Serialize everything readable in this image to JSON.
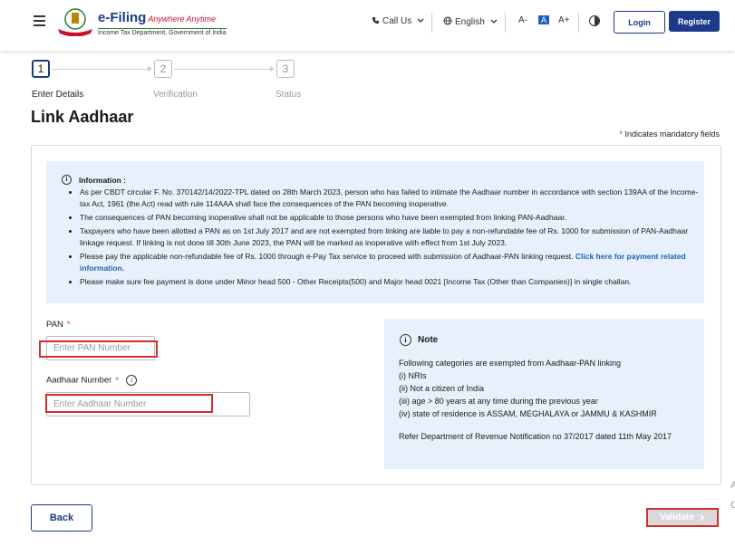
{
  "header": {
    "brand_name": "e-Filing",
    "brand_tagline": "Anywhere Anytime",
    "brand_dept": "Income Tax Department, Government of India",
    "call_us": "Call Us",
    "language": "English",
    "font_smaller": "A-",
    "font_default": "A",
    "font_larger": "A+",
    "login": "Login",
    "register": "Register"
  },
  "steps": [
    {
      "number": "1",
      "label": "Enter Details",
      "active": true
    },
    {
      "number": "2",
      "label": "Verification",
      "active": false
    },
    {
      "number": "3",
      "label": "Status",
      "active": false
    }
  ],
  "page": {
    "title": "Link Aadhaar",
    "mandatory_star": "*",
    "mandatory_text": "Indicates mandatory fields"
  },
  "info": {
    "title": "Information :",
    "items": [
      "As per CBDT circular F. No. 370142/14/2022-TPL dated on 28th March 2023, person who has failed to intimate the Aadhaar number in accordance with section 139AA of the Income-tax Act, 1961 (the Act) read with rule 114AAA shall face the consequences of the PAN becoming inoperative.",
      "The consequences of PAN becoming inoperative shall not be applicable to those persons who have been exempted from linking PAN-Aadhaar.",
      "Taxpayers who have been allotted a PAN as on 1st July 2017 and are not exempted from linking are liable to pay a non-refundable fee of Rs. 1000 for submission of PAN-Aadhaar linkage request. If linking is not done till 30th June 2023, the PAN will be marked as inoperative with effect from 1st July 2023.",
      "Please make sure fee payment is done under Minor head 500 - Other Receipts(500) and Major head 0021 [Income Tax (Other than Companies)] in single challan."
    ],
    "payment_item_text": "Please pay the applicable non-refundable fee of Rs. 1000 through e-Pay Tax service to proceed with submission of Aadhaar-PAN linking request.",
    "payment_link": "Click here for payment related information."
  },
  "form": {
    "pan_label": "PAN",
    "pan_placeholder": "Enter PAN Number",
    "aadhaar_label": "Aadhaar Number",
    "aadhaar_placeholder": "Enter Aadhaar Number",
    "required_star": "*"
  },
  "note": {
    "title": "Note",
    "intro": "Following categories are exempted from Aadhaar-PAN linking",
    "items": [
      "(i) NRIs",
      "(ii) Not a citizen of India",
      "(iii) age > 80 years at any time during the previous year",
      "(iv) state of residence is ASSAM, MEGHALAYA or JAMMU & KASHMIR"
    ],
    "reference": "Refer Department of Revenue Notification no 37/2017 dated 11th May 2017"
  },
  "actions": {
    "back": "Back",
    "validate": "Validate"
  },
  "edge_text": [
    "A",
    "C"
  ],
  "colors": {
    "primary": "#1d3a8a",
    "link": "#1d5fbf",
    "info_bg": "#e8f1fb",
    "required": "#d32f2f",
    "highlight": "#d32f2f",
    "disabled": "#d9d9d9"
  }
}
